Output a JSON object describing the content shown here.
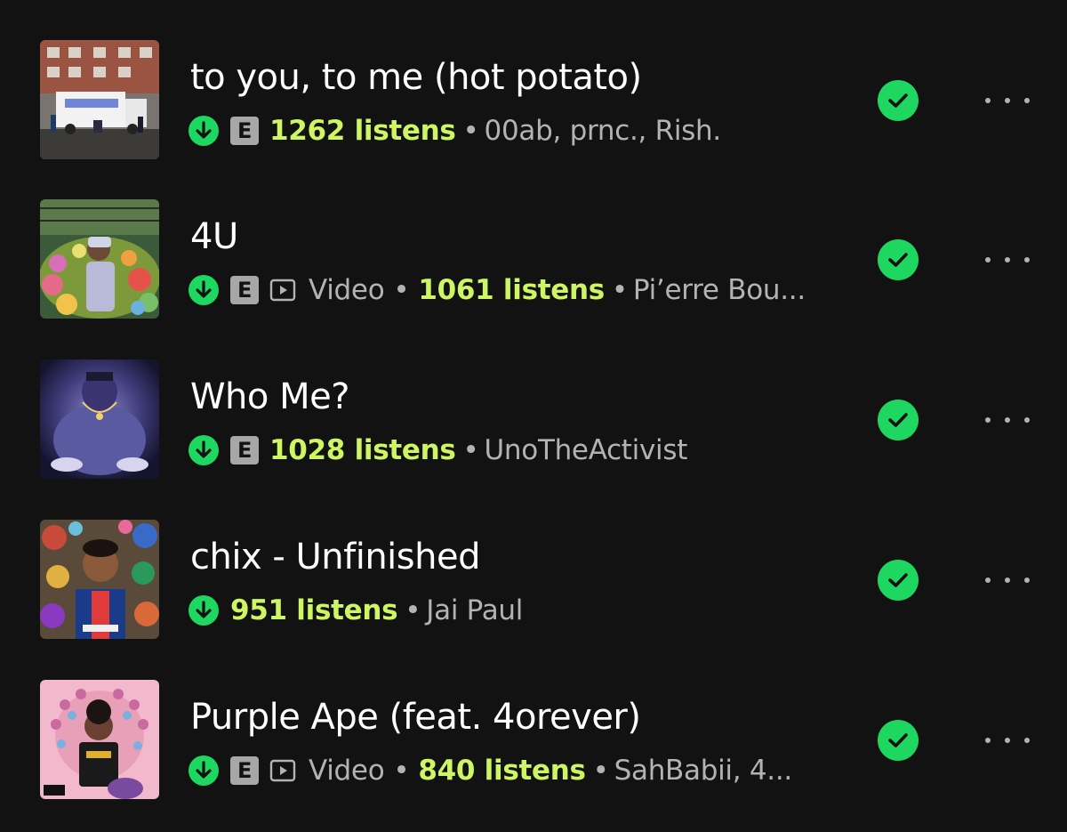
{
  "tracks": [
    {
      "title": "to you, to me (hot potato)",
      "downloaded": true,
      "explicit": true,
      "explicit_label": "E",
      "video": false,
      "listens": "1262 listens",
      "artists": "00ab, prnc., Rish.",
      "saved": true
    },
    {
      "title": "4U",
      "downloaded": true,
      "explicit": true,
      "explicit_label": "E",
      "video": true,
      "video_label": "Video",
      "listens": "1061 listens",
      "artists": "Pi’erre Bou...",
      "saved": true
    },
    {
      "title": "Who Me?",
      "downloaded": true,
      "explicit": true,
      "explicit_label": "E",
      "video": false,
      "listens": "1028 listens",
      "artists": "UnoTheActivist",
      "saved": true
    },
    {
      "title": "chix - Unfinished",
      "downloaded": true,
      "explicit": false,
      "video": false,
      "listens": "951 listens",
      "artists": "Jai Paul",
      "saved": true
    },
    {
      "title": "Purple Ape (feat. 4orever)",
      "downloaded": true,
      "explicit": true,
      "explicit_label": "E",
      "video": true,
      "video_label": "Video",
      "listens": "840 listens",
      "artists": "SahBabii, 4...",
      "saved": true
    }
  ],
  "icons": {
    "download": "download-circle-icon",
    "video": "video-play-icon",
    "saved": "check-circle-icon",
    "more": "more-options-icon"
  },
  "colors": {
    "background": "#121212",
    "accent_green": "#1ed760",
    "listens_highlight": "#cdf564",
    "secondary_text": "#b3b3b3"
  }
}
